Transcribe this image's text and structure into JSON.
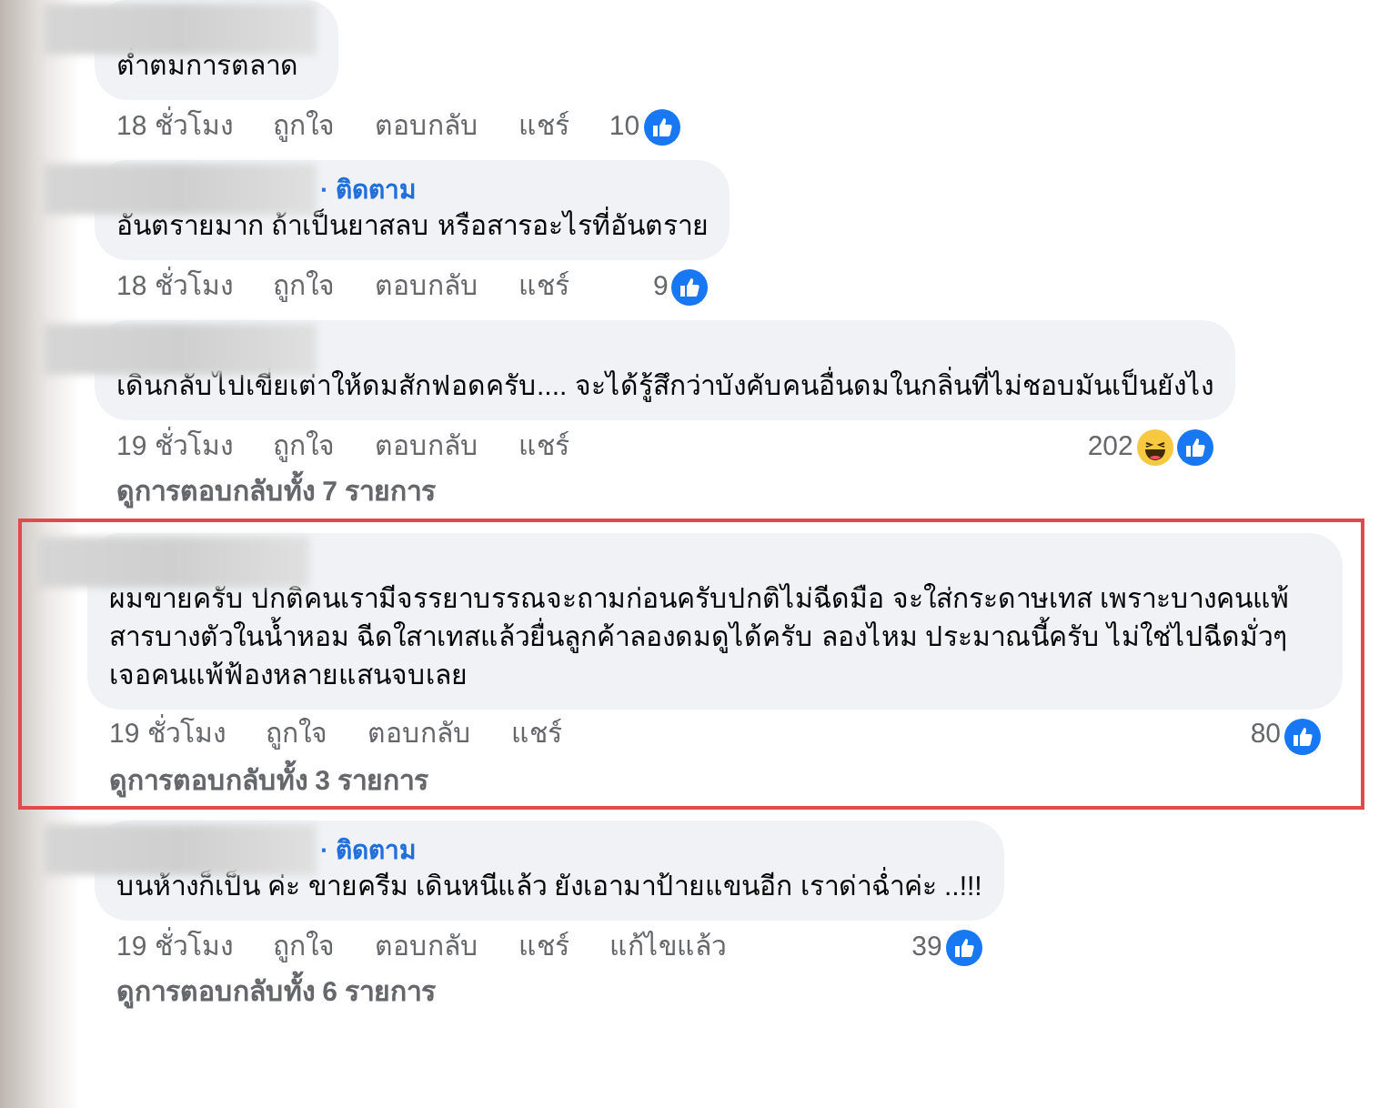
{
  "comments": [
    {
      "text": "ต่ำตมการตลาด",
      "time": "18 ชั่วโมง",
      "actions": [
        "ถูกใจ",
        "ตอบกลับ",
        "แชร์"
      ],
      "reaction_count": "10",
      "reactions": [
        {
          "kind": "like"
        }
      ],
      "highlighted": false
    },
    {
      "follow": "· ติดตาม",
      "text": "อันตรายมาก ถ้าเป็นยาสลบ หรือสารอะไรที่อันตราย",
      "time": "18 ชั่วโมง",
      "actions": [
        "ถูกใจ",
        "ตอบกลับ",
        "แชร์"
      ],
      "reaction_count": "9",
      "reactions": [
        {
          "kind": "like"
        }
      ],
      "highlighted": false
    },
    {
      "text": "เดินกลับไปเขี่ยเต่าให้ดมสักฟอดครับ.... จะได้รู้สึกว่าบังคับคนอื่นดมในกลิ่นที่ไม่ชอบมันเป็นยังไง",
      "time": "19 ชั่วโมง",
      "actions": [
        "ถูกใจ",
        "ตอบกลับ",
        "แชร์"
      ],
      "reaction_count": "202",
      "reactions": [
        {
          "kind": "haha"
        },
        {
          "kind": "like"
        }
      ],
      "highlighted": false,
      "replies_link": "ดูการตอบกลับทั้ง 7 รายการ"
    },
    {
      "text": "ผมขายครับ ปกติคนเรามีจรรยาบรรณจะถามก่อนครับปกติไม่ฉีดมือ จะใส่กระดาษเทส เพราะบางคนแพ้สารบางตัวในน้ำหอม ฉีดใสาเทสแล้วยื่นลูกค้าลองดมดูได้ครับ ลองไหม ประมาณนี้ครับ ไม่ใช่ไปฉีดมั่วๆเจอคนแพ้ฟ้องหลายแสนจบเลย",
      "time": "19 ชั่วโมง",
      "actions": [
        "ถูกใจ",
        "ตอบกลับ",
        "แชร์"
      ],
      "reaction_count": "80",
      "reactions": [
        {
          "kind": "like"
        }
      ],
      "highlighted": true,
      "replies_link": "ดูการตอบกลับทั้ง 3 รายการ"
    },
    {
      "follow": "· ติดตาม",
      "text": "บนห้างก็เป็น ค่ะ ขายครีม เดินหนีแล้ว ยังเอามาป้ายแขนอีก เราด่าฉ่ำค่ะ ..!!!",
      "time": "19 ชั่วโมง",
      "actions": [
        "ถูกใจ",
        "ตอบกลับ",
        "แชร์",
        "แก้ไขแล้ว"
      ],
      "reaction_count": "39",
      "reactions": [
        {
          "kind": "like"
        }
      ],
      "highlighted": false,
      "replies_link": "ดูการตอบกลับทั้ง 6 รายการ"
    }
  ]
}
